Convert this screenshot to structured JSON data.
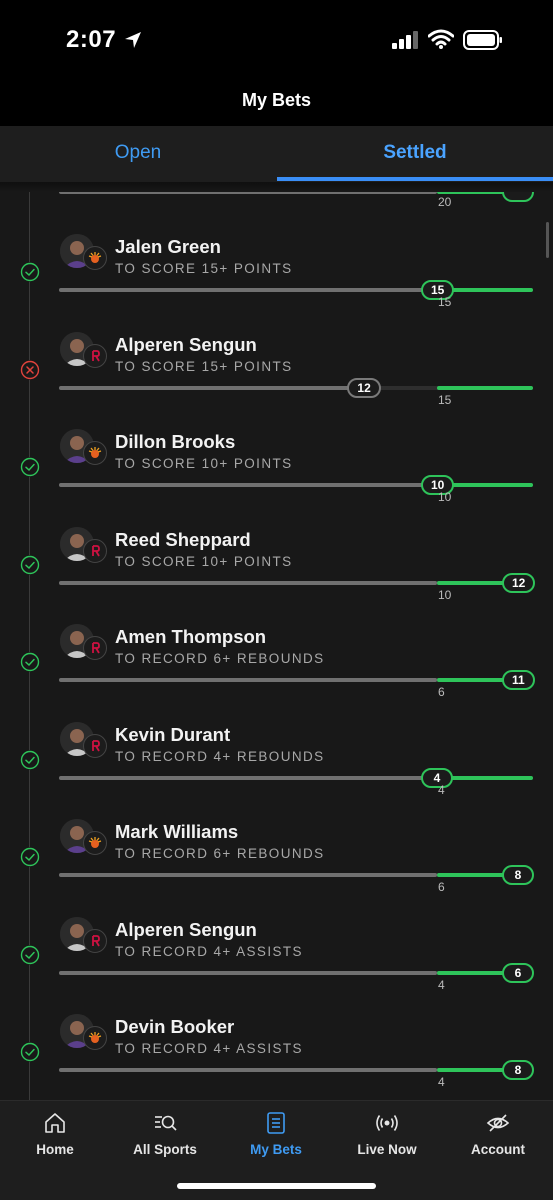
{
  "status_bar": {
    "time": "2:07"
  },
  "header": {
    "title": "My Bets"
  },
  "tabs": [
    {
      "label": "Open",
      "active": false
    },
    {
      "label": "Settled",
      "active": true
    }
  ],
  "partial_leg": {
    "threshold": "20"
  },
  "legs": [
    {
      "player": "Jalen Green",
      "team": "suns",
      "bet": "TO SCORE 15+ POINTS",
      "actual": "15",
      "threshold": "15",
      "result": "won",
      "progress": 1.0
    },
    {
      "player": "Alperen Sengun",
      "team": "rockets",
      "bet": "TO SCORE 15+ POINTS",
      "actual": "12",
      "threshold": "15",
      "result": "lost",
      "progress": 0.8
    },
    {
      "player": "Dillon Brooks",
      "team": "suns",
      "bet": "TO SCORE 10+ POINTS",
      "actual": "10",
      "threshold": "10",
      "result": "won",
      "progress": 1.0
    },
    {
      "player": "Reed Sheppard",
      "team": "rockets",
      "bet": "TO SCORE 10+ POINTS",
      "actual": "12",
      "threshold": "10",
      "result": "won",
      "progress": 1.2
    },
    {
      "player": "Amen Thompson",
      "team": "rockets",
      "bet": "TO RECORD 6+ REBOUNDS",
      "actual": "11",
      "threshold": "6",
      "result": "won",
      "progress": 1.83
    },
    {
      "player": "Kevin Durant",
      "team": "rockets",
      "bet": "TO RECORD 4+ REBOUNDS",
      "actual": "4",
      "threshold": "4",
      "result": "won",
      "progress": 1.0
    },
    {
      "player": "Mark Williams",
      "team": "suns",
      "bet": "TO RECORD 6+ REBOUNDS",
      "actual": "8",
      "threshold": "6",
      "result": "won",
      "progress": 1.33
    },
    {
      "player": "Alperen Sengun",
      "team": "rockets",
      "bet": "TO RECORD 4+ ASSISTS",
      "actual": "6",
      "threshold": "4",
      "result": "won",
      "progress": 1.5
    },
    {
      "player": "Devin Booker",
      "team": "suns",
      "bet": "TO RECORD 4+ ASSISTS",
      "actual": "8",
      "threshold": "4",
      "result": "won",
      "progress": 2.0
    }
  ],
  "bottom_nav": [
    {
      "label": "Home",
      "icon": "home-icon",
      "active": false
    },
    {
      "label": "All Sports",
      "icon": "all-sports-search-icon",
      "active": false
    },
    {
      "label": "My Bets",
      "icon": "bet-slip-icon",
      "active": true
    },
    {
      "label": "Live Now",
      "icon": "live-broadcast-icon",
      "active": false
    },
    {
      "label": "Account",
      "icon": "account-icon",
      "active": false
    }
  ],
  "colors": {
    "accent_blue": "#3f9bf3",
    "win_green": "#2ec45a",
    "loss_red": "#e0433c",
    "background": "#181818"
  }
}
